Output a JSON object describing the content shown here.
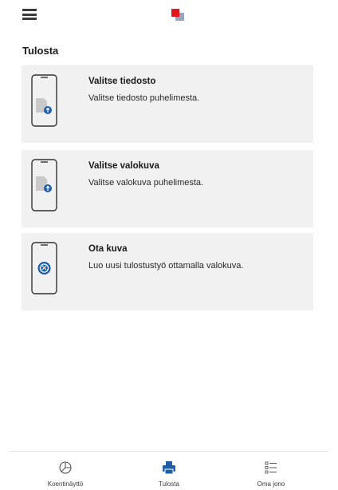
{
  "header": {
    "menu_icon": "hamburger-menu-icon",
    "logo_icon": "app-logo-icon",
    "logo_colors": {
      "front": "#e0161f",
      "back": "#9aa5bd"
    }
  },
  "page": {
    "title": "Tulosta"
  },
  "cards": [
    {
      "title": "Valitse tiedosto",
      "description": "Valitse tiedosto puhelimesta.",
      "icon": "phone-file-upload-icon"
    },
    {
      "title": "Valitse valokuva",
      "description": "Valitse valokuva puhelimesta.",
      "icon": "phone-photo-upload-icon"
    },
    {
      "title": "Ota kuva",
      "description": "Luo uusi tulostustyö ottamalla valokuva.",
      "icon": "phone-camera-icon"
    }
  ],
  "bottom_nav": {
    "items": [
      {
        "label": "Koentinäyttö",
        "icon": "home-screen-icon",
        "active": false
      },
      {
        "label": "Tulosta",
        "icon": "printer-icon",
        "active": true
      },
      {
        "label": "Oma jono",
        "icon": "list-queue-icon",
        "active": false
      }
    ]
  },
  "colors": {
    "accent": "#1f5fa8",
    "card_bg": "#f1f1f1",
    "text": "#1a1a1a"
  }
}
